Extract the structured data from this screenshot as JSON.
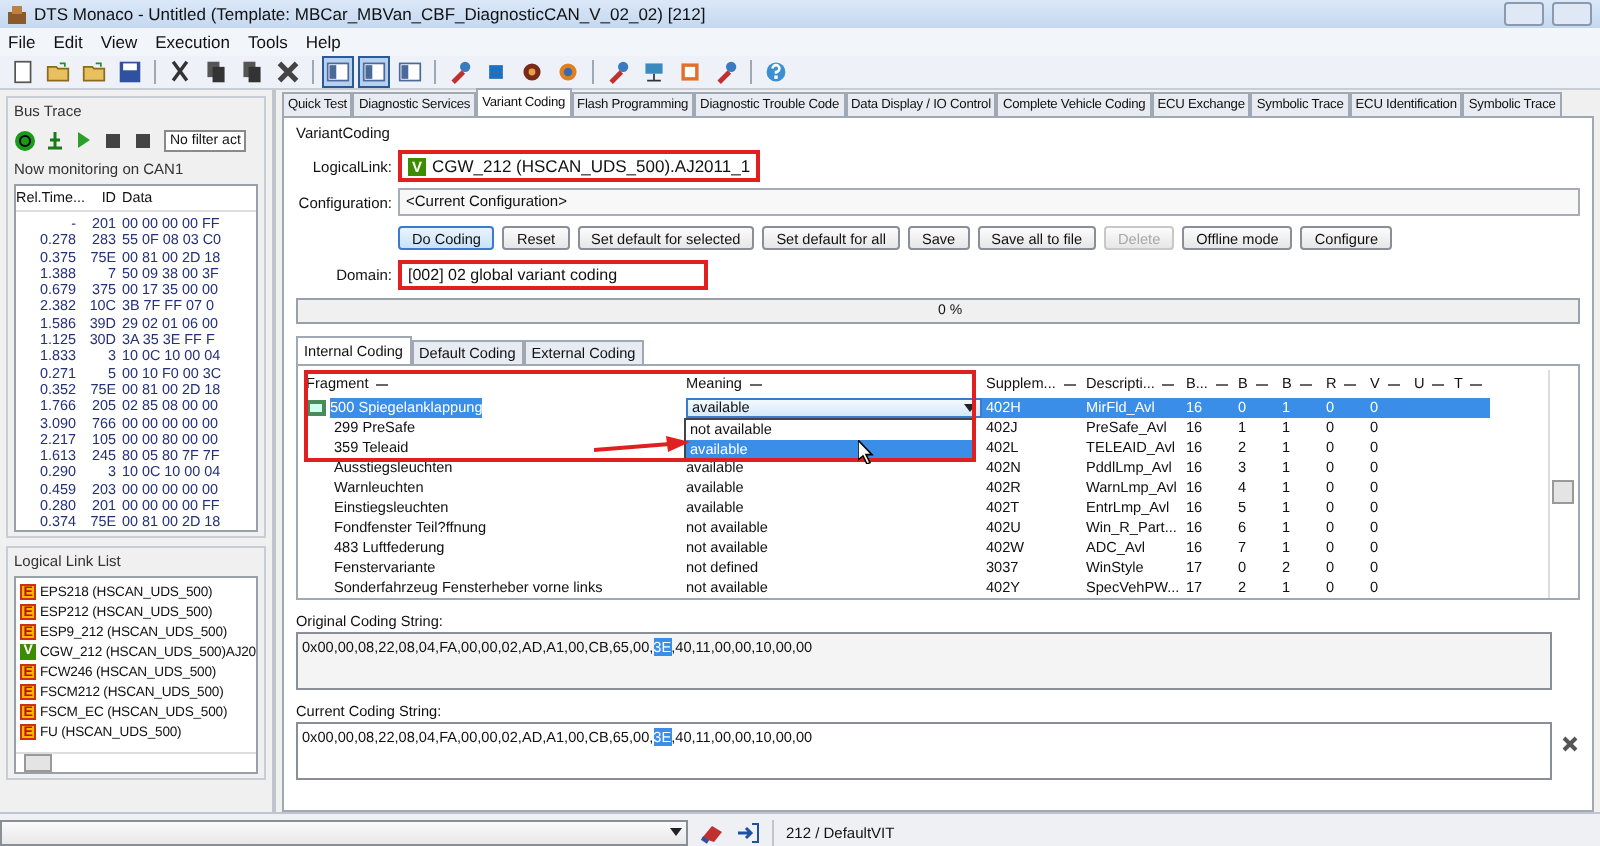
{
  "window": {
    "title": "DTS Monaco  - Untitled (Template: MBCar_MBVan_CBF_DiagnosticCAN_V_02_02) [212]"
  },
  "menu": [
    "File",
    "Edit",
    "View",
    "Execution",
    "Tools",
    "Help"
  ],
  "toolbar": {
    "layout_buttons": [
      {
        "pressed": true
      },
      {
        "pressed": true
      },
      {
        "pressed": false
      }
    ]
  },
  "bus_trace": {
    "title": "Bus Trace",
    "filter": "No filter act",
    "monitoring": "Now monitoring on CAN1",
    "columns": [
      "Rel.Time...",
      "ID",
      "Data"
    ],
    "rows": [
      [
        "-",
        "201",
        "00 00 00 00 FF"
      ],
      [
        "0.278",
        "283",
        "55 0F 08 03 C0"
      ],
      [
        "0.375",
        "75E",
        "00 81 00 2D 18"
      ],
      [
        "1.388",
        "7",
        "50 09 38 00 3F"
      ],
      [
        "0.679",
        "375",
        "00 17 35 00 00"
      ],
      [
        "2.382",
        "10C",
        "3B 7F FF 07 0"
      ],
      [
        "1.586",
        "39D",
        "29 02 01 06 00"
      ],
      [
        "1.125",
        "30D",
        "3A 35 3E FF F"
      ],
      [
        "1.833",
        "3",
        "10 0C 10 00 04"
      ],
      [
        "0.271",
        "5",
        "00 10 F0 00 3C"
      ],
      [
        "0.352",
        "75E",
        "00 81 00 2D 18"
      ],
      [
        "1.766",
        "205",
        "02 85 08 00 00"
      ],
      [
        "3.090",
        "766",
        "00 00 00 00 00"
      ],
      [
        "2.217",
        "105",
        "00 00 80 00 00"
      ],
      [
        "1.613",
        "245",
        "80 05 80 7F 7F"
      ],
      [
        "0.290",
        "3",
        "10 0C 10 00 04"
      ],
      [
        "0.459",
        "203",
        "00 00 00 00 00"
      ],
      [
        "0.280",
        "201",
        "00 00 00 00 FF"
      ],
      [
        "0.374",
        "75E",
        "00 81 00 2D 18"
      ]
    ]
  },
  "logical_link_list": {
    "title": "Logical Link List",
    "items": [
      {
        "badge": "E",
        "color": "#f5b800",
        "label": "EPS218 (HSCAN_UDS_500)"
      },
      {
        "badge": "E",
        "color": "#f5b800",
        "label": "ESP212 (HSCAN_UDS_500)"
      },
      {
        "badge": "E",
        "color": "#f5b800",
        "label": "ESP9_212 (HSCAN_UDS_500)"
      },
      {
        "badge": "V",
        "color": "#3c8c00",
        "label": "CGW_212 (HSCAN_UDS_500)AJ20"
      },
      {
        "badge": "E",
        "color": "#f5b800",
        "label": "FCW246 (HSCAN_UDS_500)"
      },
      {
        "badge": "E",
        "color": "#f5b800",
        "label": "FSCM212 (HSCAN_UDS_500)"
      },
      {
        "badge": "E",
        "color": "#f5b800",
        "label": "FSCM_EC (HSCAN_UDS_500)"
      },
      {
        "badge": "E",
        "color": "#f5b800",
        "label": "FU (HSCAN_UDS_500)"
      }
    ]
  },
  "tabs": [
    {
      "label": "Quick Test",
      "selected": false
    },
    {
      "label": "Diagnostic Services",
      "selected": false
    },
    {
      "label": "Variant Coding",
      "selected": true
    },
    {
      "label": "Flash Programming",
      "selected": false
    },
    {
      "label": "Diagnostic Trouble Code",
      "selected": false
    },
    {
      "label": "Data Display / IO Control",
      "selected": false
    },
    {
      "label": "Complete Vehicle Coding",
      "selected": false
    },
    {
      "label": "ECU Exchange",
      "selected": false
    },
    {
      "label": "Symbolic Trace",
      "selected": false
    },
    {
      "label": "ECU Identification",
      "selected": false
    },
    {
      "label": "Symbolic Trace",
      "selected": false
    }
  ],
  "variant_coding": {
    "title": "VariantCoding",
    "logical_link": {
      "label": "LogicalLink:",
      "badge": "V",
      "value": "CGW_212 (HSCAN_UDS_500).AJ2011_1"
    },
    "configuration": {
      "label": "Configuration:",
      "value": "<Current Configuration>"
    },
    "buttons": [
      {
        "label": "Do Coding",
        "disabled": false,
        "focused": true
      },
      {
        "label": "Reset",
        "disabled": false,
        "focused": false
      },
      {
        "label": "Set default for selected",
        "disabled": false,
        "focused": false
      },
      {
        "label": "Set default for all",
        "disabled": false,
        "focused": false
      },
      {
        "label": "Save",
        "disabled": false,
        "focused": false
      },
      {
        "label": "Save all to file",
        "disabled": false,
        "focused": false
      },
      {
        "label": "Delete",
        "disabled": true,
        "focused": false
      },
      {
        "label": "Offline mode",
        "disabled": false,
        "focused": false
      },
      {
        "label": "Configure",
        "disabled": false,
        "focused": false
      }
    ],
    "domain": {
      "label": "Domain:",
      "value": "[002] 02 global variant coding"
    },
    "progress": {
      "label": "0 %",
      "level": 0
    }
  },
  "coding_tabs": [
    {
      "label": "Internal Coding",
      "selected": true
    },
    {
      "label": "Default Coding",
      "selected": false
    },
    {
      "label": "External Coding",
      "selected": false
    }
  ],
  "table": {
    "columns": [
      "Fragment",
      "Meaning",
      "Supplem...",
      "Descripti...",
      "B...",
      "B",
      "B",
      "R",
      "V",
      "U",
      "T"
    ],
    "rows": [
      {
        "cells": [
          "500 Spiegelanklappung",
          "available",
          "402H",
          "MirFld_Avl",
          "16",
          "0",
          "1",
          "0",
          "0",
          "",
          ""
        ],
        "selected": true
      },
      {
        "cells": [
          "299 PreSafe",
          "",
          "402J",
          "PreSafe_Avl",
          "16",
          "1",
          "1",
          "0",
          "0",
          "",
          ""
        ],
        "selected": false
      },
      {
        "cells": [
          "359 Teleaid",
          "",
          "402L",
          "TELEAID_Avl",
          "16",
          "2",
          "1",
          "0",
          "0",
          "",
          ""
        ],
        "selected": false
      },
      {
        "cells": [
          "Ausstiegsleuchten",
          "available",
          "402N",
          "PddlLmp_Avl",
          "16",
          "3",
          "1",
          "0",
          "0",
          "",
          ""
        ],
        "selected": false
      },
      {
        "cells": [
          "Warnleuchten",
          "available",
          "402R",
          "WarnLmp_Avl",
          "16",
          "4",
          "1",
          "0",
          "0",
          "",
          ""
        ],
        "selected": false
      },
      {
        "cells": [
          "Einstiegsleuchten",
          "available",
          "402T",
          "EntrLmp_Avl",
          "16",
          "5",
          "1",
          "0",
          "0",
          "",
          ""
        ],
        "selected": false
      },
      {
        "cells": [
          "Fondfenster Teil?ffnung",
          "not available",
          "402U",
          "Win_R_Part...",
          "16",
          "6",
          "1",
          "0",
          "0",
          "",
          ""
        ],
        "selected": false
      },
      {
        "cells": [
          "483 Luftfederung",
          "not available",
          "402W",
          "ADC_Avl",
          "16",
          "7",
          "1",
          "0",
          "0",
          "",
          ""
        ],
        "selected": false
      },
      {
        "cells": [
          "Fenstervariante",
          "not defined",
          "3037",
          "WinStyle",
          "17",
          "0",
          "2",
          "0",
          "0",
          "",
          ""
        ],
        "selected": false
      },
      {
        "cells": [
          "Sonderfahrzeug Fensterheber vorne links",
          "not available",
          "402Y",
          "SpecVehPW...",
          "17",
          "2",
          "1",
          "0",
          "0",
          "",
          ""
        ],
        "selected": false
      }
    ],
    "dropdown_options": [
      {
        "label": "not available",
        "selected": false
      },
      {
        "label": "available",
        "selected": true
      }
    ]
  },
  "original_coding": {
    "label": "Original Coding String:",
    "before": "0x00,00,08,22,08,04,FA,00,00,02,AD,A1,00,CB,65,00,",
    "highlight": "3E",
    "after": ",40,11,00,00,10,00,00"
  },
  "current_coding": {
    "label": "Current Coding String:",
    "before": "0x00,00,08,22,08,04,FA,00,00,02,AD,A1,00,CB,65,00,",
    "highlight": "3E",
    "after": ",40,11,00,00,10,00,00"
  },
  "status_bar": {
    "text": "212 / DefaultVIT"
  }
}
